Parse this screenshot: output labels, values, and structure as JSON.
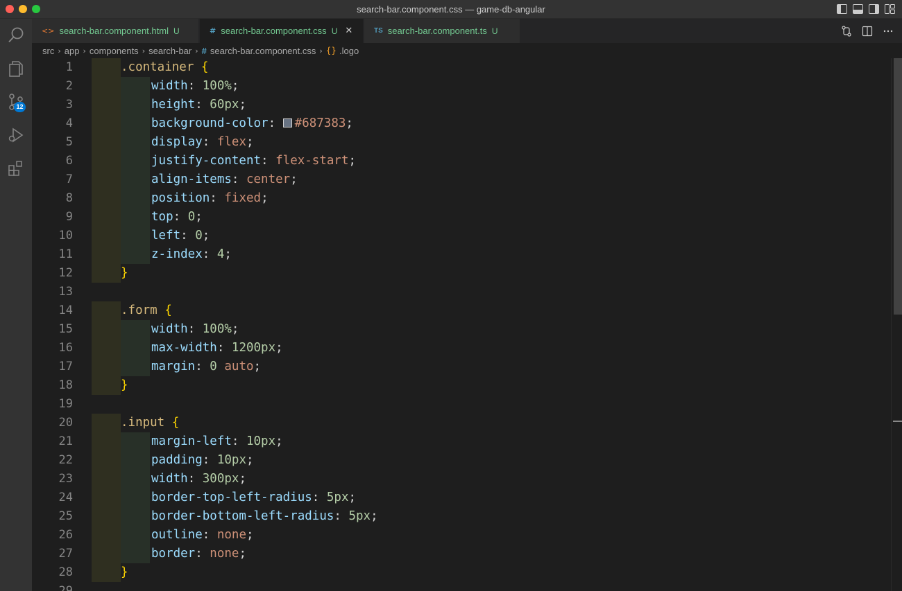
{
  "window": {
    "title": "search-bar.component.css — game-db-angular"
  },
  "activity_bar": {
    "source_control_badge": "12"
  },
  "tabs": [
    {
      "icon": "<>",
      "label": "search-bar.component.html",
      "status": "U",
      "active": false
    },
    {
      "icon": "#",
      "label": "search-bar.component.css",
      "status": "U",
      "close": "✕",
      "active": true
    },
    {
      "icon": "TS",
      "label": "search-bar.component.ts",
      "status": "U",
      "active": false
    }
  ],
  "breadcrumb": {
    "items": [
      "src",
      "app",
      "components",
      "search-bar"
    ],
    "file_icon": "#",
    "file": "search-bar.component.css",
    "symbol_icon": "{}",
    "symbol": ".logo"
  },
  "colors": {
    "swatch": "#687383",
    "accent": "#0078d4"
  },
  "code": {
    "lines": [
      {
        "n": "1",
        "tokens": [
          [
            "sel",
            ".container"
          ],
          [
            "punc",
            " "
          ],
          [
            "brace",
            "{"
          ]
        ],
        "guide": 1
      },
      {
        "n": "2",
        "tokens": [
          [
            "prop",
            "width"
          ],
          [
            "punc",
            ": "
          ],
          [
            "num",
            "100%"
          ],
          [
            "punc",
            ";"
          ]
        ],
        "guide": 2
      },
      {
        "n": "3",
        "tokens": [
          [
            "prop",
            "height"
          ],
          [
            "punc",
            ": "
          ],
          [
            "num",
            "60px"
          ],
          [
            "punc",
            ";"
          ]
        ],
        "guide": 2
      },
      {
        "n": "4",
        "tokens": [
          [
            "prop",
            "background-color"
          ],
          [
            "punc",
            ": "
          ],
          [
            "swatch",
            ""
          ],
          [
            "kw",
            "#687383"
          ],
          [
            "punc",
            ";"
          ]
        ],
        "guide": 2
      },
      {
        "n": "5",
        "tokens": [
          [
            "prop",
            "display"
          ],
          [
            "punc",
            ": "
          ],
          [
            "kw",
            "flex"
          ],
          [
            "punc",
            ";"
          ]
        ],
        "guide": 2
      },
      {
        "n": "6",
        "tokens": [
          [
            "prop",
            "justify-content"
          ],
          [
            "punc",
            ": "
          ],
          [
            "kw",
            "flex-start"
          ],
          [
            "punc",
            ";"
          ]
        ],
        "guide": 2
      },
      {
        "n": "7",
        "tokens": [
          [
            "prop",
            "align-items"
          ],
          [
            "punc",
            ": "
          ],
          [
            "kw",
            "center"
          ],
          [
            "punc",
            ";"
          ]
        ],
        "guide": 2
      },
      {
        "n": "8",
        "tokens": [
          [
            "prop",
            "position"
          ],
          [
            "punc",
            ": "
          ],
          [
            "kw",
            "fixed"
          ],
          [
            "punc",
            ";"
          ]
        ],
        "guide": 2
      },
      {
        "n": "9",
        "tokens": [
          [
            "prop",
            "top"
          ],
          [
            "punc",
            ": "
          ],
          [
            "num",
            "0"
          ],
          [
            "punc",
            ";"
          ]
        ],
        "guide": 2
      },
      {
        "n": "10",
        "tokens": [
          [
            "prop",
            "left"
          ],
          [
            "punc",
            ": "
          ],
          [
            "num",
            "0"
          ],
          [
            "punc",
            ";"
          ]
        ],
        "guide": 2
      },
      {
        "n": "11",
        "tokens": [
          [
            "prop",
            "z-index"
          ],
          [
            "punc",
            ": "
          ],
          [
            "num",
            "4"
          ],
          [
            "punc",
            ";"
          ]
        ],
        "guide": 2
      },
      {
        "n": "12",
        "tokens": [
          [
            "brace",
            "}"
          ]
        ],
        "guide": 1
      },
      {
        "n": "13",
        "tokens": [],
        "guide": 0
      },
      {
        "n": "14",
        "tokens": [
          [
            "sel",
            ".form"
          ],
          [
            "punc",
            " "
          ],
          [
            "brace",
            "{"
          ]
        ],
        "guide": 1
      },
      {
        "n": "15",
        "tokens": [
          [
            "prop",
            "width"
          ],
          [
            "punc",
            ": "
          ],
          [
            "num",
            "100%"
          ],
          [
            "punc",
            ";"
          ]
        ],
        "guide": 2
      },
      {
        "n": "16",
        "tokens": [
          [
            "prop",
            "max-width"
          ],
          [
            "punc",
            ": "
          ],
          [
            "num",
            "1200px"
          ],
          [
            "punc",
            ";"
          ]
        ],
        "guide": 2
      },
      {
        "n": "17",
        "tokens": [
          [
            "prop",
            "margin"
          ],
          [
            "punc",
            ": "
          ],
          [
            "num",
            "0"
          ],
          [
            "punc",
            " "
          ],
          [
            "kw",
            "auto"
          ],
          [
            "punc",
            ";"
          ]
        ],
        "guide": 2
      },
      {
        "n": "18",
        "tokens": [
          [
            "brace",
            "}"
          ]
        ],
        "guide": 1
      },
      {
        "n": "19",
        "tokens": [],
        "guide": 0
      },
      {
        "n": "20",
        "tokens": [
          [
            "sel",
            ".input"
          ],
          [
            "punc",
            " "
          ],
          [
            "brace",
            "{"
          ]
        ],
        "guide": 1
      },
      {
        "n": "21",
        "tokens": [
          [
            "prop",
            "margin-left"
          ],
          [
            "punc",
            ": "
          ],
          [
            "num",
            "10px"
          ],
          [
            "punc",
            ";"
          ]
        ],
        "guide": 2
      },
      {
        "n": "22",
        "tokens": [
          [
            "prop",
            "padding"
          ],
          [
            "punc",
            ": "
          ],
          [
            "num",
            "10px"
          ],
          [
            "punc",
            ";"
          ]
        ],
        "guide": 2
      },
      {
        "n": "23",
        "tokens": [
          [
            "prop",
            "width"
          ],
          [
            "punc",
            ": "
          ],
          [
            "num",
            "300px"
          ],
          [
            "punc",
            ";"
          ]
        ],
        "guide": 2
      },
      {
        "n": "24",
        "tokens": [
          [
            "prop",
            "border-top-left-radius"
          ],
          [
            "punc",
            ": "
          ],
          [
            "num",
            "5px"
          ],
          [
            "punc",
            ";"
          ]
        ],
        "guide": 2
      },
      {
        "n": "25",
        "tokens": [
          [
            "prop",
            "border-bottom-left-radius"
          ],
          [
            "punc",
            ": "
          ],
          [
            "num",
            "5px"
          ],
          [
            "punc",
            ";"
          ]
        ],
        "guide": 2
      },
      {
        "n": "26",
        "tokens": [
          [
            "prop",
            "outline"
          ],
          [
            "punc",
            ": "
          ],
          [
            "kw",
            "none"
          ],
          [
            "punc",
            ";"
          ]
        ],
        "guide": 2
      },
      {
        "n": "27",
        "tokens": [
          [
            "prop",
            "border"
          ],
          [
            "punc",
            ": "
          ],
          [
            "kw",
            "none"
          ],
          [
            "punc",
            ";"
          ]
        ],
        "guide": 2
      },
      {
        "n": "28",
        "tokens": [
          [
            "brace",
            "}"
          ]
        ],
        "guide": 1
      },
      {
        "n": "29",
        "tokens": [],
        "guide": 0
      }
    ]
  }
}
